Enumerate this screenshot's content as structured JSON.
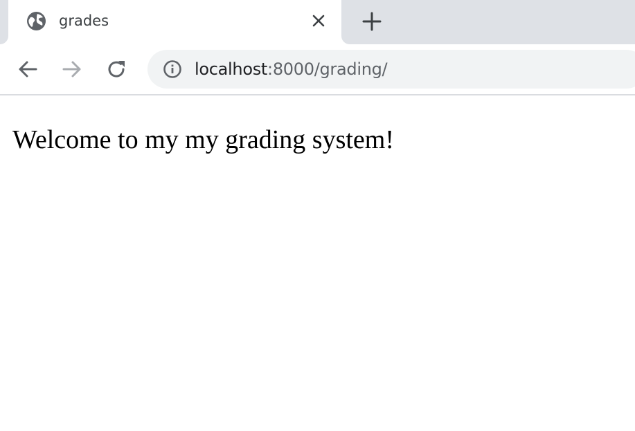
{
  "browser": {
    "tab": {
      "title": "grades",
      "favicon": "globe-icon",
      "close_icon": "close-icon"
    },
    "new_tab_icon": "plus-icon",
    "toolbar": {
      "back_icon": "arrow-left-icon",
      "forward_icon": "arrow-right-icon",
      "reload_icon": "reload-icon",
      "site_info_icon": "info-icon",
      "url_host": "localhost",
      "url_path": ":8000/grading/"
    }
  },
  "page": {
    "heading": "Welcome to my my grading system!"
  },
  "colors": {
    "tab_strip_bg": "#dee1e6",
    "omnibox_bg": "#f1f3f4",
    "icon_dark": "#5f6368",
    "icon_disabled": "#a9acb0",
    "text_primary": "#202124"
  }
}
